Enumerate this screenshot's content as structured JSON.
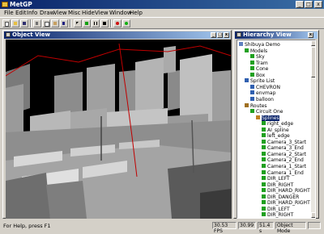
{
  "window": {
    "title": "MetGP"
  },
  "menu": [
    "File",
    "Edit",
    "Info",
    "Draw",
    "View",
    "Misc",
    "Hide",
    "View",
    "Window",
    "Help"
  ],
  "toolbar": {
    "buttons": [
      "new-file-icon",
      "open-folder-icon",
      "save-icon",
      "cut-icon",
      "copy-icon",
      "paste-icon",
      "help-icon",
      "pointer-icon",
      "play-icon",
      "pause-icon",
      "stop-icon",
      "record-icon",
      "green-dot-icon"
    ]
  },
  "object_view": {
    "title": "Object View"
  },
  "hierarchy": {
    "title": "Hierarchy View",
    "items": [
      {
        "label": "Shibuya Demo",
        "depth": 0,
        "icon": "scene"
      },
      {
        "label": "Models",
        "depth": 1,
        "icon": "green"
      },
      {
        "label": "Sky",
        "depth": 2,
        "icon": "green"
      },
      {
        "label": "Tram",
        "depth": 2,
        "icon": "green"
      },
      {
        "label": "Cone",
        "depth": 2,
        "icon": "green"
      },
      {
        "label": "Box",
        "depth": 2,
        "icon": "green"
      },
      {
        "label": "Sprite List",
        "depth": 1,
        "icon": "sprite"
      },
      {
        "label": "CHEVRON",
        "depth": 2,
        "icon": "sprite"
      },
      {
        "label": "envmap",
        "depth": 2,
        "icon": "sprite"
      },
      {
        "label": "balloon",
        "depth": 2,
        "icon": "sprite"
      },
      {
        "label": "Routes",
        "depth": 1,
        "icon": "route"
      },
      {
        "label": "Circuit One",
        "depth": 2,
        "icon": "green"
      },
      {
        "label": "Splines",
        "depth": 3,
        "icon": "spline",
        "selected": true
      },
      {
        "label": "right_edge",
        "depth": 4,
        "icon": "green"
      },
      {
        "label": "AI_spline",
        "depth": 4,
        "icon": "green"
      },
      {
        "label": "left_edge",
        "depth": 4,
        "icon": "green"
      },
      {
        "label": "Camera_3_Start",
        "depth": 4,
        "icon": "green"
      },
      {
        "label": "Camera_3_End",
        "depth": 4,
        "icon": "green"
      },
      {
        "label": "Camera_2_Start",
        "depth": 4,
        "icon": "green"
      },
      {
        "label": "Camera_2_End",
        "depth": 4,
        "icon": "green"
      },
      {
        "label": "Camera_1_Start",
        "depth": 4,
        "icon": "green"
      },
      {
        "label": "Camera_1_End",
        "depth": 4,
        "icon": "green"
      },
      {
        "label": "DIR_LEFT",
        "depth": 4,
        "icon": "green"
      },
      {
        "label": "DIR_RIGHT",
        "depth": 4,
        "icon": "green"
      },
      {
        "label": "DIR_HARD_RIGHT",
        "depth": 4,
        "icon": "green"
      },
      {
        "label": "DIR_DANGER",
        "depth": 4,
        "icon": "green"
      },
      {
        "label": "DIR_HARD_RIGHT",
        "depth": 4,
        "icon": "green"
      },
      {
        "label": "DIR_LEFT",
        "depth": 4,
        "icon": "green"
      },
      {
        "label": "DIR_RIGHT",
        "depth": 4,
        "icon": "green"
      }
    ]
  },
  "status": {
    "help": "For Help, press F1",
    "fields": [
      "30.53 FPS",
      "30.99",
      "51.4 s",
      "Object Mode",
      ""
    ]
  },
  "colors": {
    "accent": "#0a246a",
    "node_green": "#20a020",
    "route_line": "#c00000"
  }
}
